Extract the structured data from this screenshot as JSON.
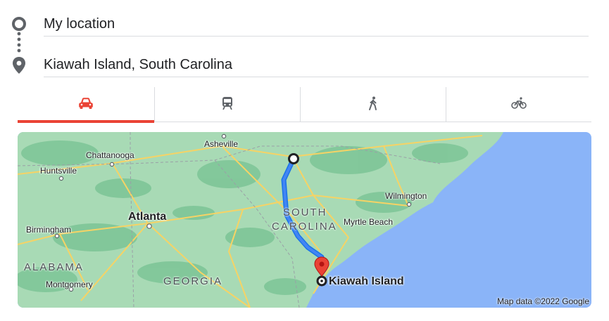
{
  "origin": {
    "label": "My location",
    "icon": "origin-circle-icon"
  },
  "destination": {
    "label": "Kiawah Island, South Carolina",
    "icon": "map-pin-icon"
  },
  "travel_modes": [
    {
      "name": "driving",
      "icon": "car-icon",
      "active": true
    },
    {
      "name": "transit",
      "icon": "train-icon",
      "active": false
    },
    {
      "name": "walking",
      "icon": "walking-person-icon",
      "active": false
    },
    {
      "name": "cycling",
      "icon": "bicycle-icon",
      "active": false
    }
  ],
  "colors": {
    "active_tab": "#ea4335",
    "route": "#4285f4",
    "water": "#8ab4f8",
    "land": "#a8dab5",
    "forest": "#7cc496",
    "road": "#f6d365",
    "pin": "#ea4335"
  },
  "map": {
    "labels": {
      "asheville": "Asheville",
      "chattanooga": "Chattanooga",
      "huntsville": "Huntsville",
      "wilmington": "Wilmington",
      "south": "SOUTH",
      "carolina": "CAROLINA",
      "myrtle_beach": "Myrtle Beach",
      "atlanta": "Atlanta",
      "birmingham": "Birmingham",
      "alabama": "ALABAMA",
      "montgomery": "Montgomery",
      "georgia": "GEORGIA",
      "kiawah_island": "Kiawah Island"
    },
    "attribution": "Map data ©2022 Google"
  }
}
